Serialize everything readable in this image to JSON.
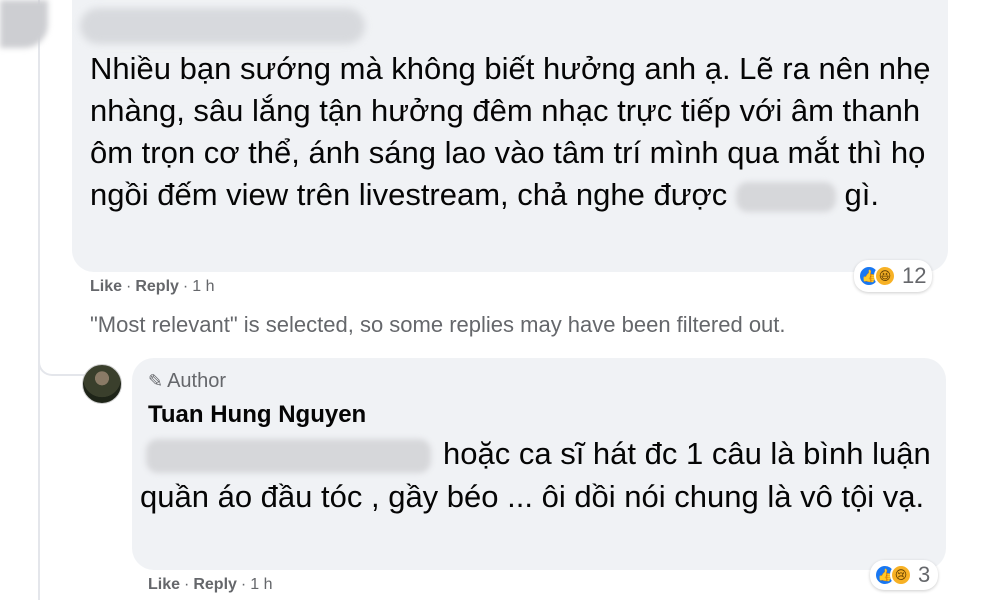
{
  "parent_comment": {
    "text_before": "Nhiều bạn sướng mà không biết hưởng anh ạ. Lẽ ra nên nhẹ nhàng, sâu lắng tận hưởng đêm nhạc trực tiếp với âm thanh ôm trọn cơ thể, ánh sáng lao vào tâm trí mình qua mắt thì họ ngồi đếm view trên livestream, chả nghe được",
    "text_after": "gì.",
    "reaction_count": "12",
    "reaction_icons": [
      "like-icon",
      "haha-icon"
    ],
    "actions": {
      "like": "Like",
      "reply": "Reply",
      "time": "1 h"
    }
  },
  "filter_note": "\"Most relevant\" is selected, so some replies may have been filtered out.",
  "reply_comment": {
    "badge": "Author",
    "author_name": "Tuan Hung Nguyen",
    "text": "hoặc ca sĩ hát đc 1 câu là bình luận quần áo đầu tóc , gầy béo ... ôi dồi nói chung là vô tội vạ.",
    "reaction_count": "3",
    "reaction_icons": [
      "like-icon",
      "sad-icon"
    ],
    "actions": {
      "like": "Like",
      "reply": "Reply",
      "time": "1 h"
    }
  },
  "colors": {
    "bubble_bg": "#f0f2f5",
    "meta_text": "#65676b",
    "like_blue": "#1877f2",
    "emoji_yellow": "#f7b125"
  }
}
